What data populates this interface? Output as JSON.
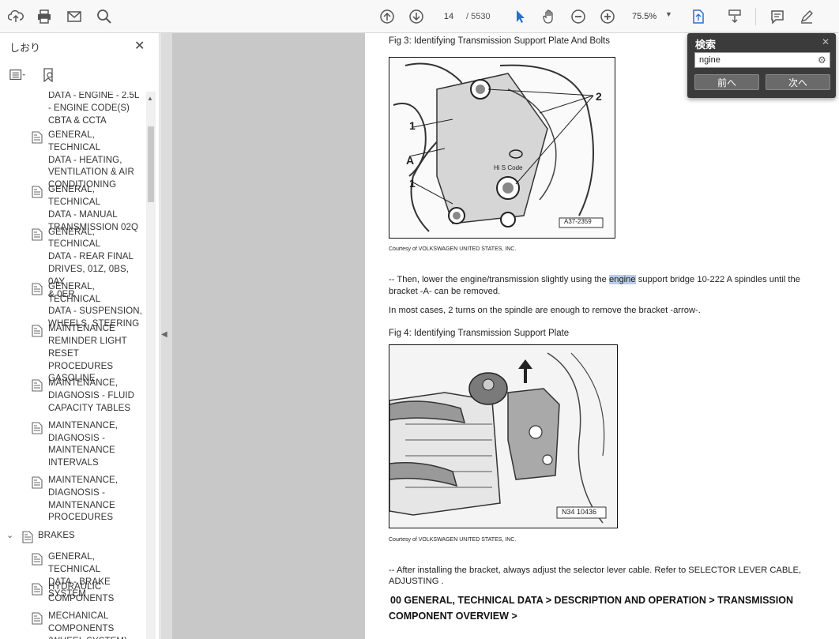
{
  "toolbar": {
    "page_current": "14",
    "page_total": "/ 5530",
    "zoom": "75.5%"
  },
  "sidebar": {
    "title": "しおり",
    "partial_top": [
      "DATA - ENGINE - 2.5L",
      "- ENGINE CODE(S)",
      "CBTA & CCTA"
    ],
    "items": [
      {
        "lines": [
          "GENERAL, TECHNICAL",
          "DATA - HEATING,",
          "VENTILATION & AIR",
          "CONDITIONING"
        ]
      },
      {
        "lines": [
          "GENERAL, TECHNICAL",
          "DATA - MANUAL",
          "TRANSMISSION 02Q"
        ]
      },
      {
        "lines": [
          "GENERAL, TECHNICAL",
          "DATA - REAR FINAL",
          "DRIVES, 01Z, 0BS, 0AY",
          "& 0ER"
        ]
      },
      {
        "lines": [
          "GENERAL, TECHNICAL",
          "DATA - SUSPENSION,",
          "WHEELS, STEERING"
        ]
      },
      {
        "lines": [
          "MAINTENANCE",
          "REMINDER LIGHT",
          "RESET PROCEDURES",
          "GASOLINE"
        ]
      },
      {
        "lines": [
          "MAINTENANCE,",
          "DIAGNOSIS - FLUID",
          "CAPACITY TABLES"
        ]
      },
      {
        "lines": [
          "MAINTENANCE,",
          "DIAGNOSIS -",
          "MAINTENANCE",
          "INTERVALS"
        ]
      },
      {
        "lines": [
          "MAINTENANCE,",
          "DIAGNOSIS -",
          "MAINTENANCE",
          "PROCEDURES"
        ]
      }
    ],
    "group": "BRAKES",
    "sub_items": [
      {
        "lines": [
          "GENERAL, TECHNICAL",
          "DATA - BRAKE SYSTEM"
        ]
      },
      {
        "lines": [
          "HYDRAULIC",
          "COMPONENTS"
        ]
      },
      {
        "lines": [
          "MECHANICAL",
          "COMPONENTS",
          "(WHEEL SYSTEM)"
        ]
      }
    ]
  },
  "document": {
    "fig3_caption": "Fig 3: Identifying Transmission Support Plate And Bolts",
    "fig3_labels": {
      "l1": "1",
      "l2": "2",
      "la": "A",
      "l1b": "1",
      "code": "A37-2359"
    },
    "courtesy1": "Courtesy of VOLKSWAGEN UNITED STATES, INC.",
    "para1_pre": "-- Then, lower the engine/transmission slightly using the ",
    "para1_hl": "engine",
    "para1_post": " support bridge 10-222 A spindles until the",
    "para1_line2": "bracket -A- can be removed.",
    "para2": "In most cases, 2 turns on the spindle are enough to remove the bracket -arrow-.",
    "fig4_caption": "Fig 4: Identifying Transmission Support Plate",
    "fig4_code": "N34 10436",
    "courtesy2": "Courtesy of VOLKSWAGEN UNITED STATES, INC.",
    "para3_line1": "-- After installing the bracket, always adjust the selector lever cable. Refer to SELECTOR LEVER CABLE,",
    "para3_line2": "ADJUSTING .",
    "section_line1": "00 GENERAL, TECHNICAL DATA >  DESCRIPTION AND OPERATION >  TRANSMISSION",
    "section_line2": "COMPONENT OVERVIEW >"
  },
  "find": {
    "title": "検索",
    "query": "ngine",
    "prev": "前へ",
    "next": "次へ"
  }
}
